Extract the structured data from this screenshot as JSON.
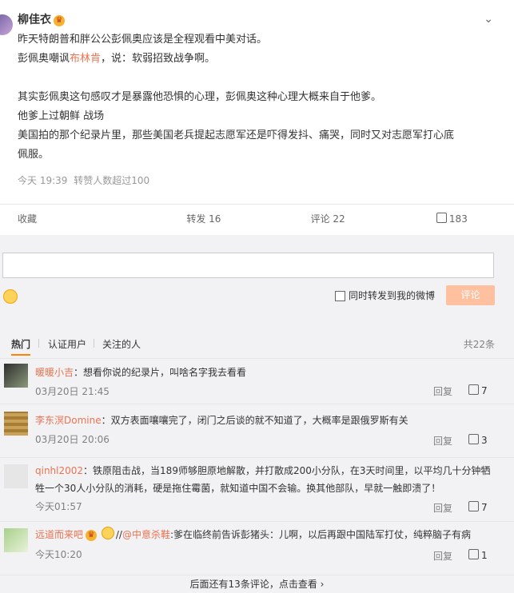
{
  "post": {
    "author": "柳佳衣",
    "lines": [
      "昨天特朗普和胖公公彭佩奥应该是全程观看中美对话。",
      "彭佩奥嘲讽",
      "其实彭佩奥这句感叹才是暴露他恐惧的心理，彭佩奥这种心理大概来自于他爹。",
      "他爹上过朝鲜 战场",
      "美国拍的那个纪录片里，那些美国老兵提起志愿军还是吓得发抖、痛哭，同时又对志愿军打心底",
      "佩服。"
    ],
    "link_text": "布林肯",
    "line2_tail": "，说：软弱招致战争啊。",
    "time": "今天 19:39",
    "forward_note": "转赞人数超过100"
  },
  "actions": {
    "favorite": "收藏",
    "forward": "转发 16",
    "comment": "评论 22",
    "like": "183"
  },
  "composer": {
    "forward_checkbox_label": "同时转发到我的微博",
    "submit": "评论"
  },
  "tabs": {
    "hot": "热门",
    "verified": "认证用户",
    "following": "关注的人",
    "total": "共22条"
  },
  "comments": [
    {
      "name": "暖暖小吉",
      "text": "：想看你说的纪录片，叫啥名字我去看看",
      "time": "03月20日 21:45",
      "reply": "回复",
      "likes": "7"
    },
    {
      "name": "李东溟Domine",
      "text": "：双方表面嚷嚷完了，闭门之后谈的就不知道了，大概率是跟俄罗斯有关",
      "time": "03月20日 20:06",
      "reply": "回复",
      "likes": "3"
    },
    {
      "name": "qinhl2002",
      "text": "：铁原阻击战，当189师够胆原地解散，并打散成200小分队，在3天时间里，以平均几十分钟牺牲一个30人小分队的消耗，硬是拖住霉菌，就知道中国不会输。换其他部队，早就一触即溃了！",
      "time": "今天01:57",
      "reply": "回复",
      "likes": "7"
    },
    {
      "name": "远道而来吧",
      "text_at": "@中意杀鞋",
      "text": ":爹在临终前告诉彭猪头：儿啊，以后再跟中国陆军打仗，纯粹脑子有病",
      "time": "今天10:20",
      "reply": "回复",
      "likes": "1"
    }
  ],
  "more": "后面还有13条评论，点击查看 ›"
}
